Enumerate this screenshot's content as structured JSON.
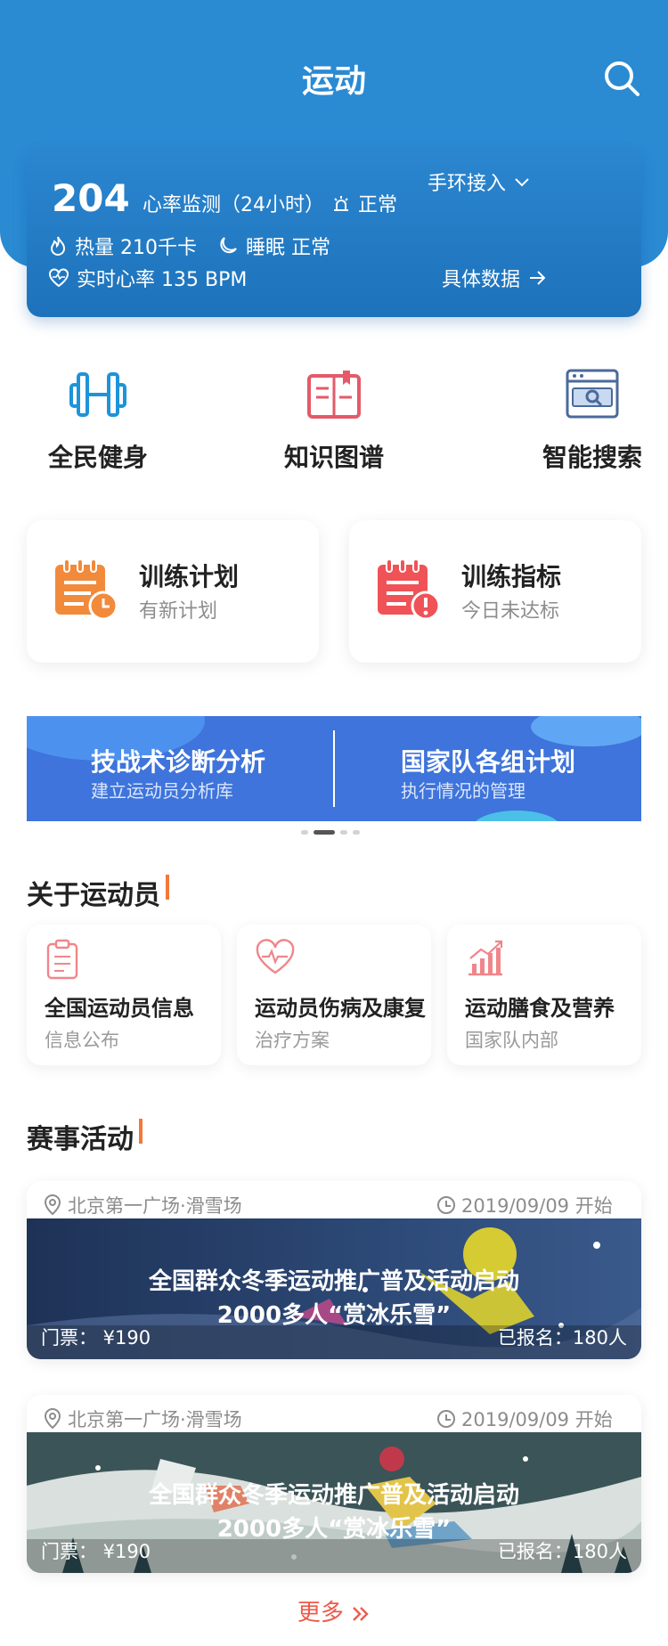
{
  "header": {
    "title": "运动"
  },
  "monitor": {
    "heart_value": "204",
    "monitor_label": "心率监测（24小时）",
    "status_text": "正常",
    "device_label": "手环接入",
    "calories": "热量 210千卡",
    "sleep": "睡眠 正常",
    "realtime": "实时心率 135 BPM",
    "detail_link": "具体数据"
  },
  "features": [
    {
      "label": "全民健身",
      "icon": "dumbbell-icon"
    },
    {
      "label": "知识图谱",
      "icon": "book-icon"
    },
    {
      "label": "智能搜索",
      "icon": "browser-search-icon"
    }
  ],
  "plans": [
    {
      "title": "训练计划",
      "subtitle": "有新计划",
      "icon": "calendar-clock-icon",
      "color": "#f28a3c"
    },
    {
      "title": "训练指标",
      "subtitle": "今日未达标",
      "icon": "calendar-alert-icon",
      "color": "#ef5357"
    }
  ],
  "banner": {
    "left_title": "技战术诊断分析",
    "left_sub": "建立运动员分析库",
    "right_title": "国家队各组计划",
    "right_sub": "执行情况的管理"
  },
  "sections": {
    "athletes_title": "关于运动员",
    "events_title": "赛事活动"
  },
  "athletes": [
    {
      "title": "全国运动员信息",
      "subtitle": "信息公布",
      "icon": "clipboard-icon"
    },
    {
      "title": "运动员伤病及康复",
      "subtitle": "治疗方案",
      "icon": "heart-pulse-icon"
    },
    {
      "title": "运动膳食及营养",
      "subtitle": "国家队内部",
      "icon": "chart-growth-icon"
    }
  ],
  "events": [
    {
      "location": "北京第一广场·滑雪场",
      "time": "2019/09/09 开始",
      "headline1": "全国群众冬季运动推广普及活动启动",
      "headline2": "2000多人“赏冰乐雪”",
      "ticket": "门票：  ¥190",
      "signed": "已报名：180人"
    },
    {
      "location": "北京第一广场·滑雪场",
      "time": "2019/09/09 开始",
      "headline1": "全国群众冬季运动推广普及活动启动",
      "headline2": "2000多人“赏冰乐雪”",
      "ticket": "门票：  ¥190",
      "signed": "已报名：180人"
    }
  ],
  "more_label": "更多",
  "colors": {
    "primary": "#2a8ad2",
    "accent": "#f07a3a",
    "more": "#ef5a4a"
  }
}
